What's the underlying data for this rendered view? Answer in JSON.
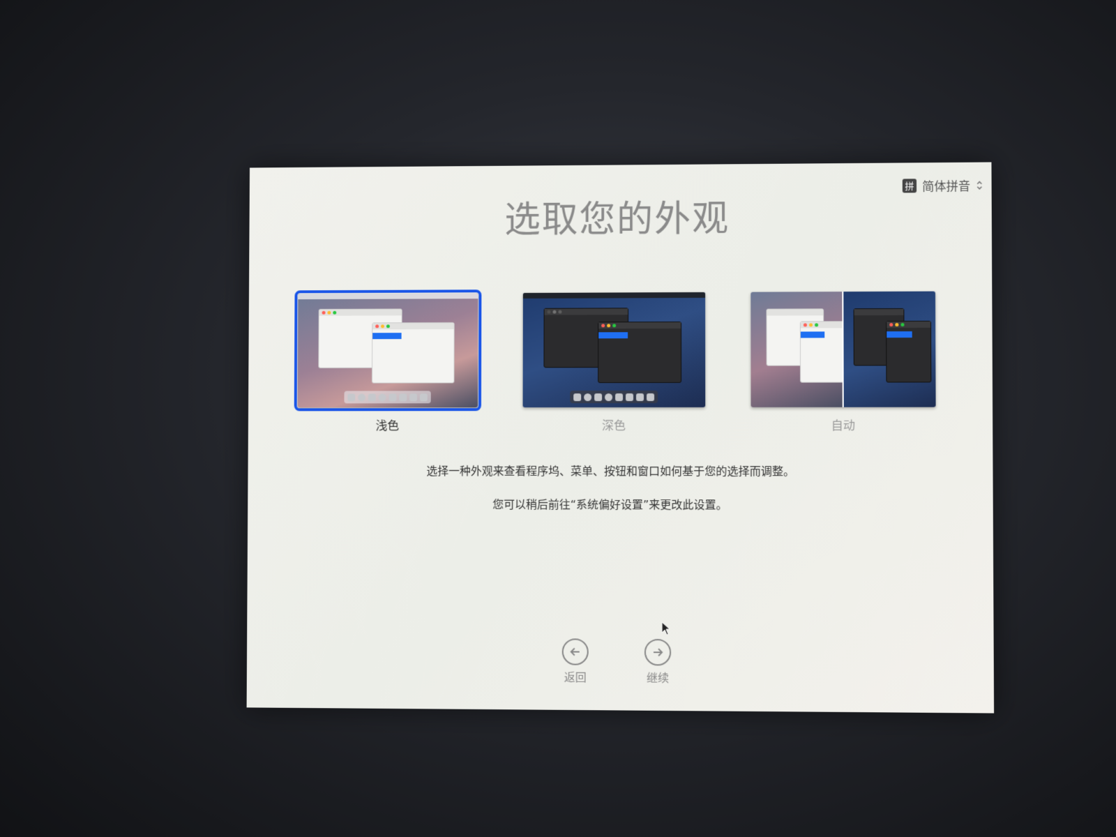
{
  "input_source": {
    "badge": "拼",
    "label": "简体拼音"
  },
  "title": "选取您的外观",
  "options": [
    {
      "label": "浅色",
      "selected": true
    },
    {
      "label": "深色",
      "selected": false
    },
    {
      "label": "自动",
      "selected": false
    }
  ],
  "description": {
    "line1": "选择一种外观来查看程序坞、菜单、按钮和窗口如何基于您的选择而调整。",
    "line2": "您可以稍后前往“系统偏好设置”来更改此设置。"
  },
  "nav": {
    "back_label": "返回",
    "continue_label": "继续"
  },
  "colors": {
    "selection": "#1a55e8",
    "background": "#efefea"
  }
}
